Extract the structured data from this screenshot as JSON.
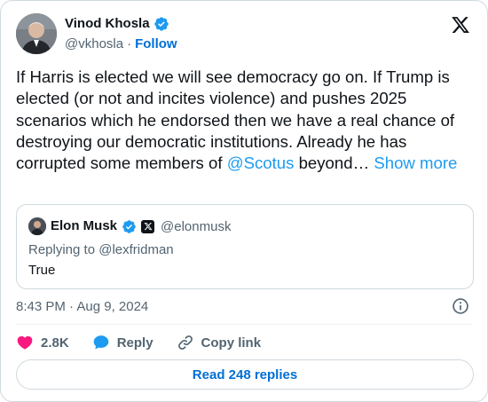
{
  "author": {
    "name": "Vinod Khosla",
    "handle": "@vkhosla",
    "separator": "·",
    "follow_label": "Follow"
  },
  "tweet": {
    "text_before": "If Harris is elected we will see democracy go on. If Trump is elected (or not and incites violence) and pushes 2025 scenarios which he endorsed then we have a real chance of destroying our democratic institutions. Already he has corrupted some members of ",
    "mention": "@Scotus",
    "text_after": " beyond… ",
    "show_more": "Show more"
  },
  "quoted": {
    "name": "Elon Musk",
    "handle": "@elonmusk",
    "replying_to": "Replying to @lexfridman",
    "text": "True"
  },
  "timestamp": "8:43 PM · Aug 9, 2024",
  "actions": {
    "likes": "2.8K",
    "reply_label": "Reply",
    "copy_link_label": "Copy link"
  },
  "read_replies_label": "Read 248 replies",
  "colors": {
    "accent": "#1d9bf0",
    "like": "#f91880",
    "muted": "#536471"
  },
  "icons": [
    "verified-badge-icon",
    "x-logo-icon",
    "info-icon",
    "heart-icon",
    "reply-bubble-icon",
    "link-icon"
  ]
}
